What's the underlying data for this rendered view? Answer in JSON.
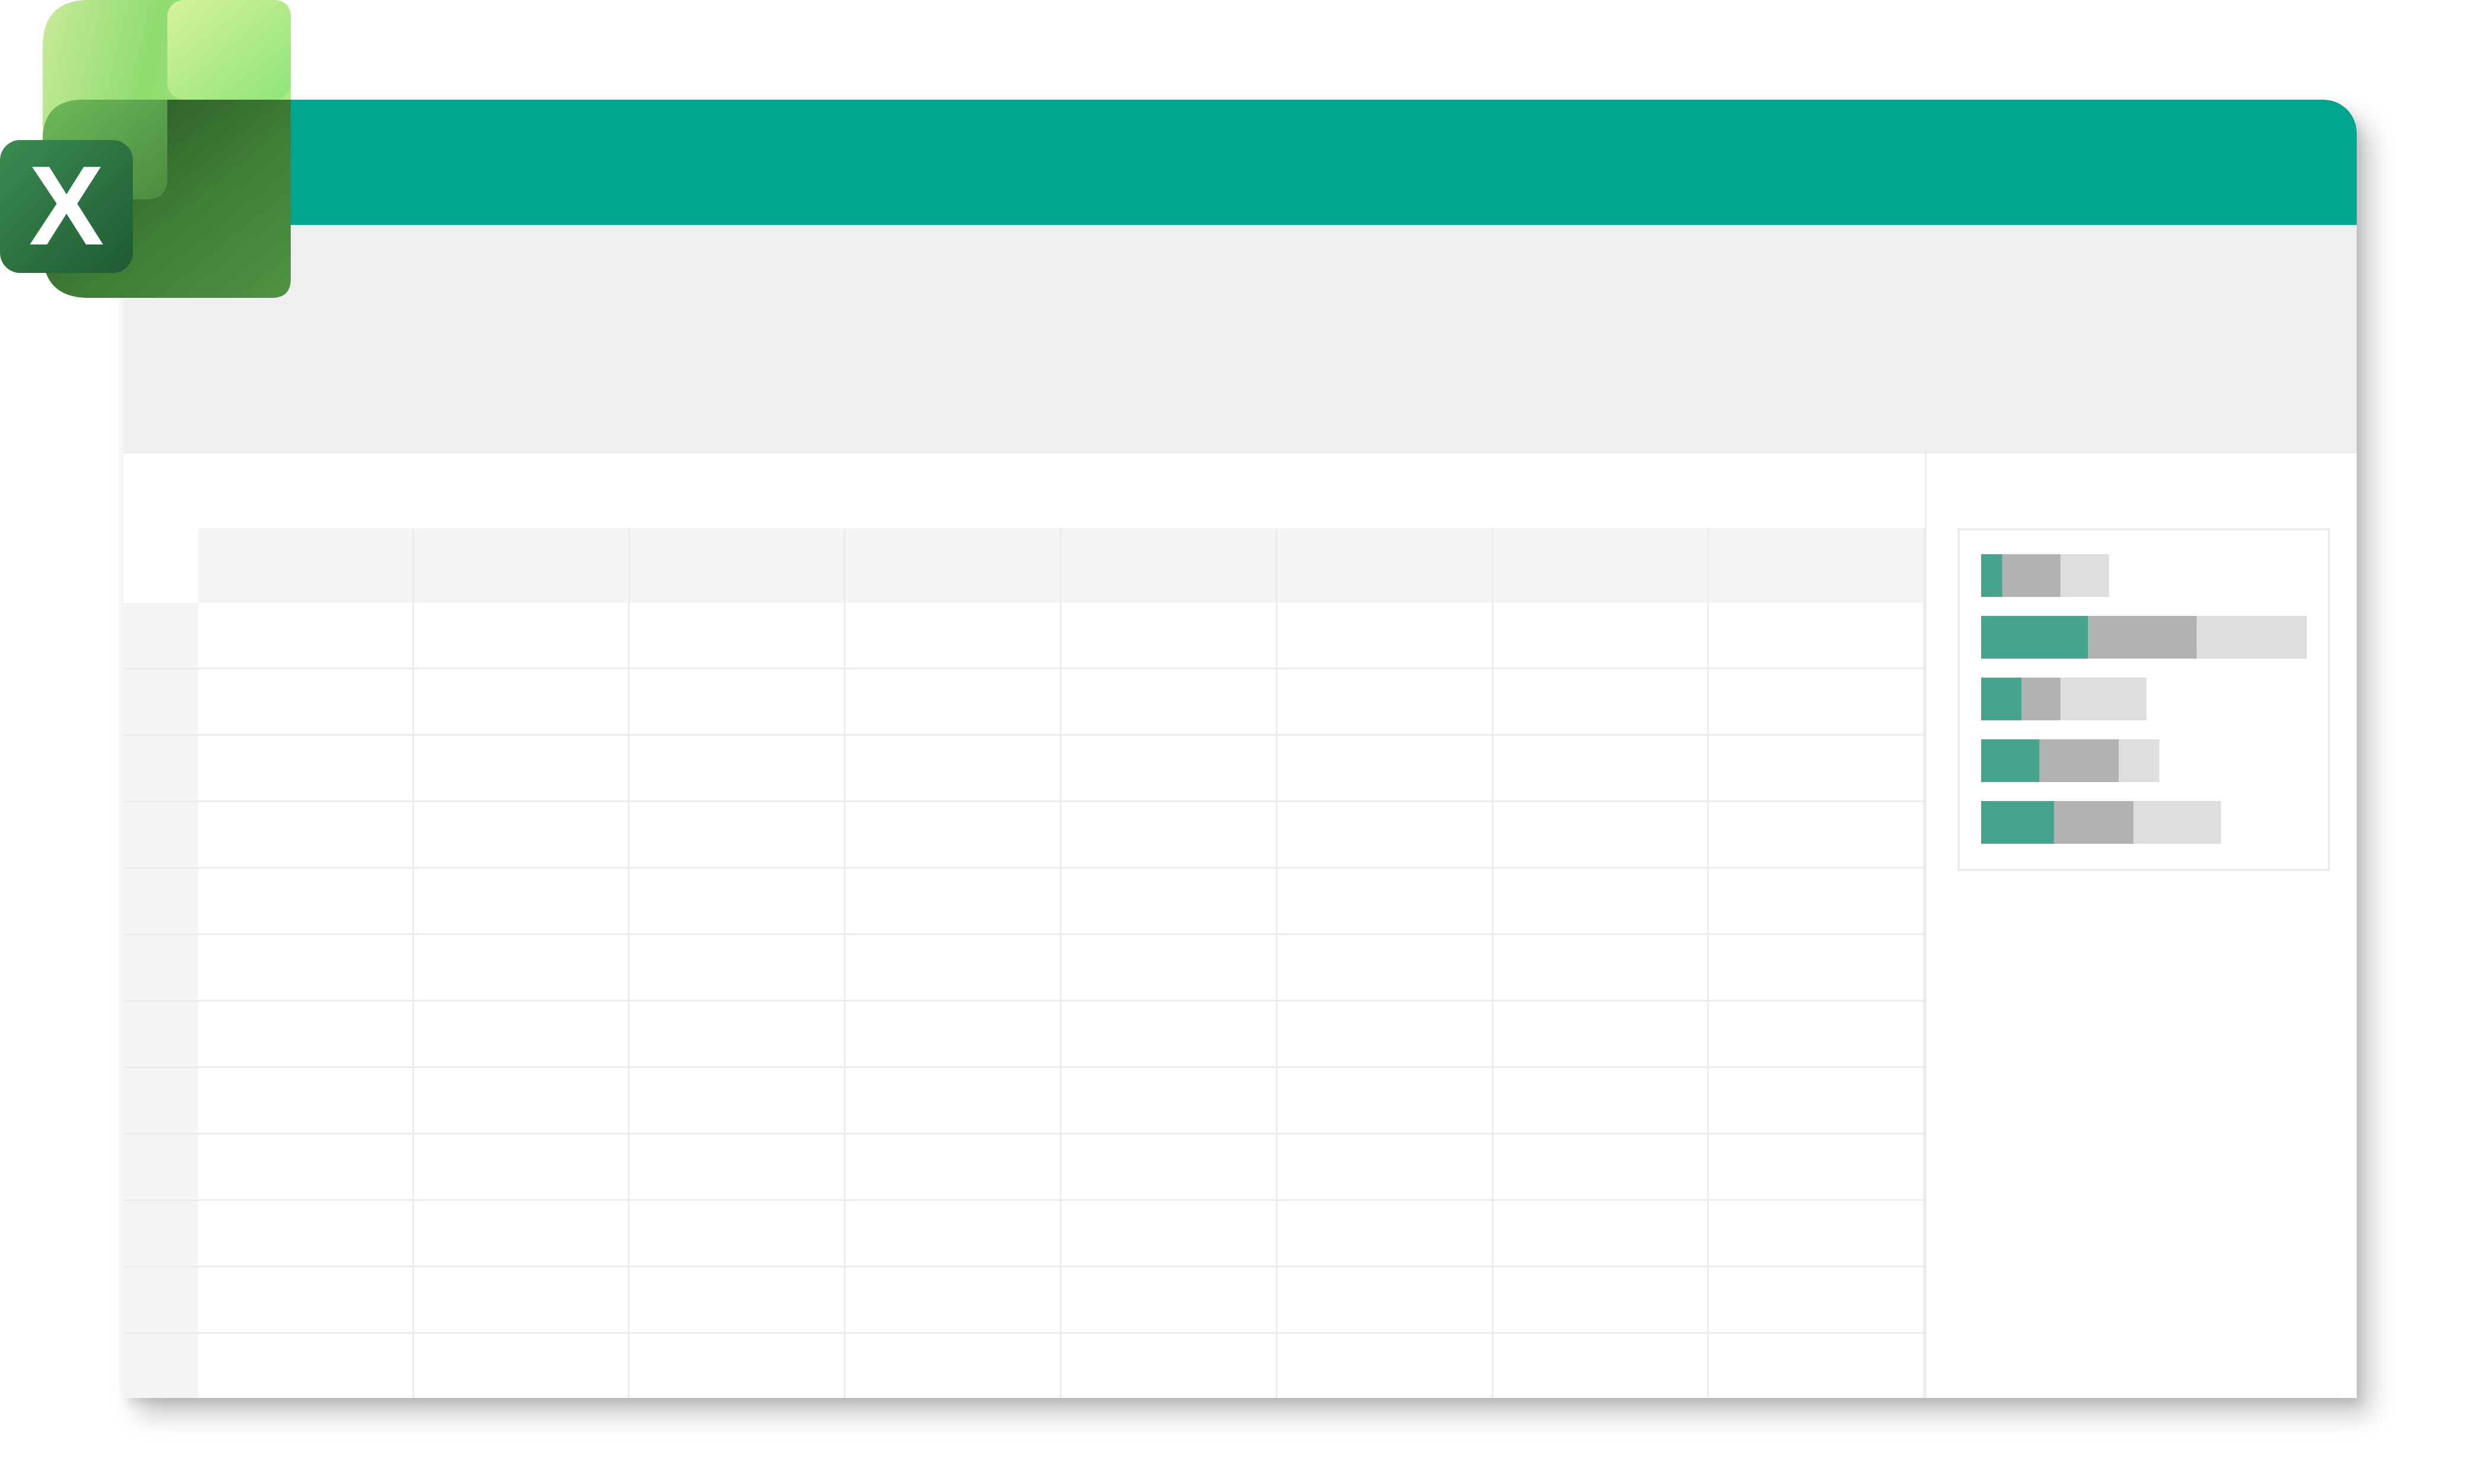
{
  "app": {
    "icon_name": "spreadsheet-app-icon",
    "icon_letter": "X"
  },
  "colors": {
    "titlebar": "#00a58f",
    "ribbon": "#efefef",
    "header_fill": "#f5f5f5",
    "gridline": "#ececec",
    "bar_primary": "#48a38d",
    "bar_secondary": "#b2b2b2",
    "bar_tertiary": "#dedede"
  },
  "grid": {
    "column_count": 8,
    "row_count": 12
  },
  "chart_data": {
    "type": "bar",
    "orientation": "horizontal",
    "stacked": true,
    "title": "",
    "xlabel": "",
    "ylabel": "",
    "categories": [
      "",
      "",
      "",
      "",
      ""
    ],
    "series": [
      {
        "values": [
          13,
          66,
          25,
          36,
          45
        ]
      },
      {
        "values": [
          36,
          67,
          24,
          49,
          49
        ]
      },
      {
        "values": [
          30,
          68,
          53,
          25,
          54
        ]
      }
    ],
    "xlim": [
      0,
      205
    ]
  }
}
